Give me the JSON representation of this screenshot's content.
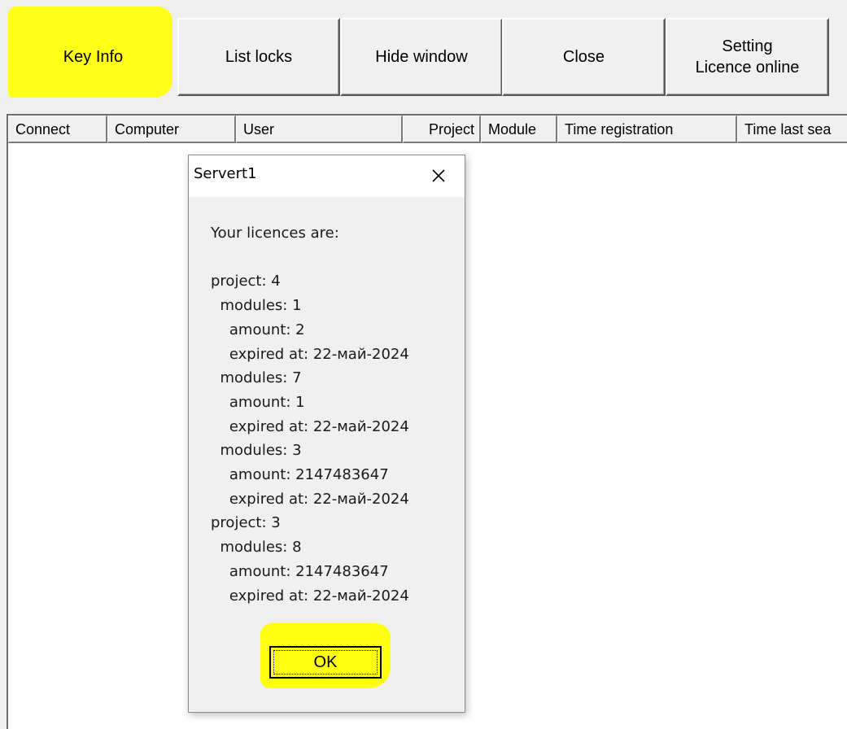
{
  "toolbar": {
    "buttons": [
      {
        "label": "Key Info"
      },
      {
        "label": "List locks"
      },
      {
        "label": "Hide window"
      },
      {
        "label": "Close"
      },
      {
        "label": "Setting\nLicence online"
      }
    ],
    "highlight_color": "#ffff18"
  },
  "list": {
    "columns": [
      "Connect",
      "Computer",
      "User",
      "Project",
      "Module",
      "Time registration",
      "Time last sea"
    ]
  },
  "dialog": {
    "title": "Servert1",
    "close_glyph": "×",
    "message_lines": [
      "Your licences are:",
      "",
      "project: 4",
      "  modules: 1",
      "    amount: 2",
      "    expired at: 22-май-2024",
      "  modules: 7",
      "    amount: 1",
      "    expired at: 22-май-2024",
      "  modules: 3",
      "    amount: 2147483647",
      "    expired at: 22-май-2024",
      "project: 3",
      "  modules: 8",
      "    amount: 2147483647",
      "    expired at: 22-май-2024"
    ],
    "ok_label": "OK"
  }
}
